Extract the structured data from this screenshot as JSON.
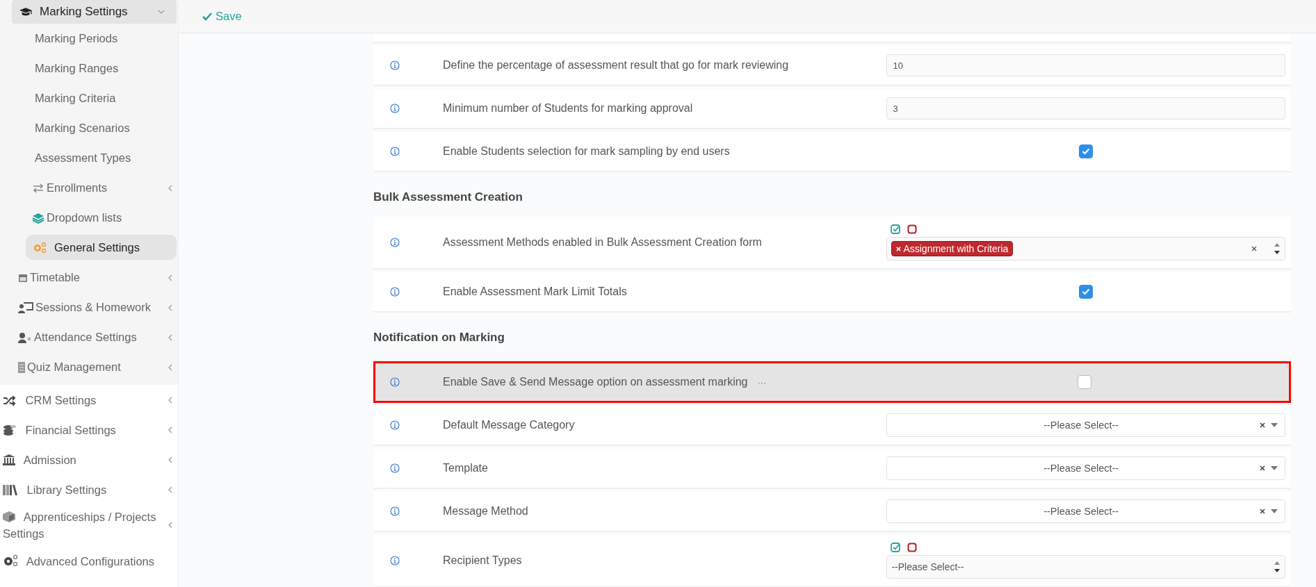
{
  "sidebar": {
    "group": {
      "label": "Marking Settings",
      "expanded": true,
      "children": [
        {
          "label": "Marking Periods",
          "selected": false,
          "has_submenu": false
        },
        {
          "label": "Marking Ranges",
          "selected": false,
          "has_submenu": false
        },
        {
          "label": "Marking Criteria",
          "selected": false,
          "has_submenu": false
        },
        {
          "label": "Marking Scenarios",
          "selected": false,
          "has_submenu": false
        },
        {
          "label": "Assessment Types",
          "selected": false,
          "has_submenu": false
        },
        {
          "label": "Enrollments",
          "selected": false,
          "has_submenu": true
        },
        {
          "label": "Dropdown lists",
          "selected": false,
          "has_submenu": false
        },
        {
          "label": "General Settings",
          "selected": true,
          "has_submenu": false
        }
      ]
    },
    "sub_items": [
      {
        "label": "Timetable",
        "has_submenu": true
      },
      {
        "label": "Sessions & Homework",
        "has_submenu": true
      },
      {
        "label": "Attendance Settings",
        "has_submenu": true
      },
      {
        "label": "Quiz Management",
        "has_submenu": true
      }
    ],
    "items": [
      {
        "label": "CRM Settings",
        "has_submenu": true
      },
      {
        "label": "Financial Settings",
        "has_submenu": true
      },
      {
        "label": "Admission",
        "has_submenu": true
      },
      {
        "label": "Library Settings",
        "has_submenu": true
      },
      {
        "label": "Apprenticeships / Projects Settings",
        "has_submenu": true
      },
      {
        "label": "Advanced Configurations",
        "has_submenu": false
      }
    ]
  },
  "toolbar": {
    "save": "Save"
  },
  "sections": [
    {
      "rows": [
        {
          "kind": "text",
          "label": "Define the percentage of assessment result that go for mark reviewing",
          "value": "10",
          "highlighted": false
        },
        {
          "kind": "text",
          "label": "Minimum number of Students for marking approval",
          "value": "3",
          "highlighted": false
        },
        {
          "kind": "checkbox",
          "label": "Enable Students selection for mark sampling by end users",
          "checked": true,
          "highlighted": false
        }
      ]
    },
    {
      "heading": "Bulk Assessment Creation",
      "rows": [
        {
          "kind": "multiselect",
          "label": "Assessment Methods enabled in Bulk Assessment Creation form",
          "tags": [
            {
              "label": "Assignment with Criteria"
            }
          ],
          "highlighted": false
        },
        {
          "kind": "checkbox",
          "label": "Enable Assessment Mark Limit Totals",
          "checked": true,
          "highlighted": false
        }
      ]
    },
    {
      "heading": "Notification on Marking",
      "rows": [
        {
          "kind": "checkbox",
          "label": "Enable Save & Send Message option on assessment marking",
          "more": "···",
          "checked": false,
          "highlighted": true
        },
        {
          "kind": "select",
          "label": "Default Message Category",
          "placeholder": "--Please Select--",
          "highlighted": false
        },
        {
          "kind": "select",
          "label": "Template",
          "placeholder": "--Please Select--",
          "highlighted": false
        },
        {
          "kind": "select",
          "label": "Message Method",
          "placeholder": "--Please Select--",
          "highlighted": false
        },
        {
          "kind": "multiselect",
          "label": "Recipient Types",
          "placeholder": "--Please Select--",
          "highlighted": false
        }
      ]
    }
  ]
}
